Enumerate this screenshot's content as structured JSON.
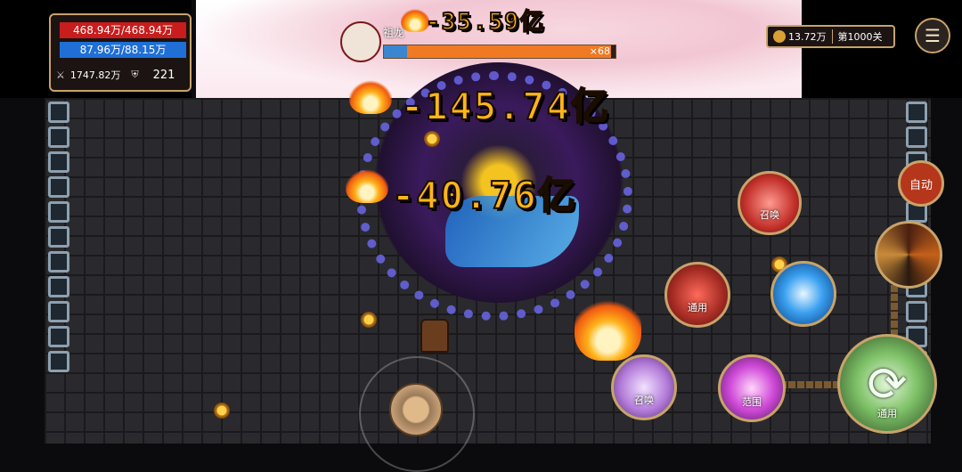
{
  "player": {
    "hp_text": "468.94万/468.94万",
    "mp_text": "87.96万/88.15万",
    "attack": "1747.82万",
    "defense": "221"
  },
  "header": {
    "gold": "13.72万",
    "stage": "第1000关"
  },
  "boss": {
    "name": "祖龙",
    "multiplier": "×68",
    "hp_fraction": 0.98
  },
  "damage_numbers": [
    "-35.59亿",
    "-145.74亿",
    "-40.76亿"
  ],
  "skills": {
    "summon_top": "召唤",
    "general_mid": "通用",
    "range": "范围",
    "summon_bottom": "召唤",
    "refresh_general": "通用"
  },
  "auto_label": "自动",
  "colors": {
    "hp": "#c91c1c",
    "mp": "#1f6fd6",
    "frame_gold": "#c9a36a",
    "damage": "#ffb51c"
  }
}
